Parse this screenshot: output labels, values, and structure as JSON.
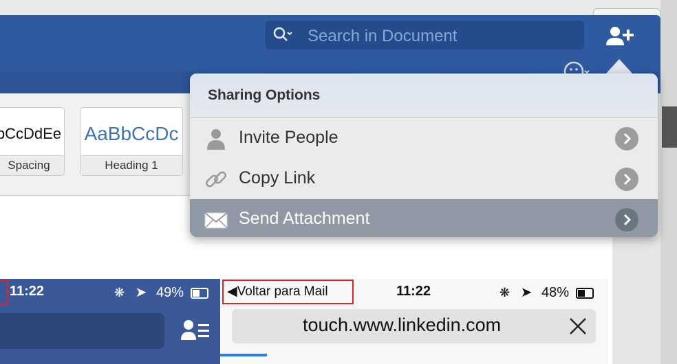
{
  "toolbar": {
    "search_placeholder": "Search in Document"
  },
  "styles": [
    {
      "sample": "bCcDdEe",
      "label": "Spacing"
    },
    {
      "sample": "AaBbCcDc",
      "label": "Heading 1"
    }
  ],
  "sharing_menu": {
    "title": "Sharing Options",
    "items": [
      {
        "label": "Invite People",
        "icon": "person-icon"
      },
      {
        "label": "Copy Link",
        "icon": "link-icon"
      },
      {
        "label": "Send Attachment",
        "icon": "envelope-icon",
        "selected": true
      }
    ]
  },
  "phone_left": {
    "time": "11:22",
    "battery": "49%"
  },
  "phone_right": {
    "back_label": "Voltar para Mail",
    "time": "11:22",
    "battery": "48%",
    "url": "touch.www.linkedin.com"
  },
  "colors": {
    "word_blue": "#2f5aa0",
    "facebook_blue": "#3b5998",
    "highlight_red": "#d8262e",
    "selected_row": "#8f98a4"
  }
}
